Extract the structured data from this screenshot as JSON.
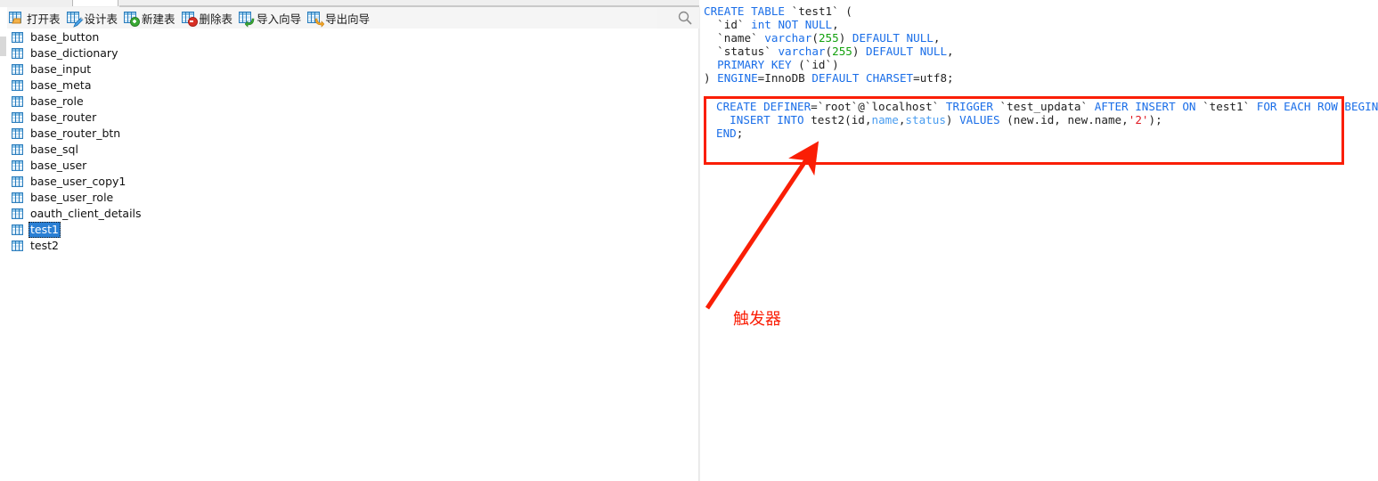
{
  "app": {
    "title": "Navicat - Table List and Trigger SQL"
  },
  "toolbar": {
    "buttons": [
      {
        "label": "打开表",
        "icon": "table-open-icon"
      },
      {
        "label": "设计表",
        "icon": "table-design-icon"
      },
      {
        "label": "新建表",
        "icon": "table-new-icon"
      },
      {
        "label": "删除表",
        "icon": "table-delete-icon"
      },
      {
        "label": "导入向导",
        "icon": "import-wizard-icon"
      },
      {
        "label": "导出向导",
        "icon": "export-wizard-icon"
      }
    ],
    "search_icon": "search-icon"
  },
  "table_list": {
    "items": [
      {
        "name": "base_button",
        "selected": false
      },
      {
        "name": "base_dictionary",
        "selected": false
      },
      {
        "name": "base_input",
        "selected": false
      },
      {
        "name": "base_meta",
        "selected": false
      },
      {
        "name": "base_role",
        "selected": false
      },
      {
        "name": "base_router",
        "selected": false
      },
      {
        "name": "base_router_btn",
        "selected": false
      },
      {
        "name": "base_sql",
        "selected": false
      },
      {
        "name": "base_user",
        "selected": false
      },
      {
        "name": "base_user_copy1",
        "selected": false
      },
      {
        "name": "base_user_role",
        "selected": false
      },
      {
        "name": "oauth_client_details",
        "selected": false
      },
      {
        "name": "test1",
        "selected": true
      },
      {
        "name": "test2",
        "selected": false
      }
    ]
  },
  "sql": {
    "create_table": {
      "line1": "CREATE TABLE `test1` (",
      "line2": "  `id` int NOT NULL,",
      "line3": "  `name` varchar(255) DEFAULT NULL,",
      "line4": "  `status` varchar(255) DEFAULT NULL,",
      "line5": "  PRIMARY KEY (`id`)",
      "line6": ") ENGINE=InnoDB DEFAULT CHARSET=utf8;"
    },
    "trigger": {
      "line1": "CREATE DEFINER=`root`@`localhost` TRIGGER `test_updata` AFTER INSERT ON `test1` FOR EACH ROW BEGIN",
      "line2": "  INSERT INTO test2(id,name,status) VALUES (new.id, new.name,'2');",
      "line3": "END;"
    }
  },
  "annotation": {
    "label": "触发器",
    "color": "#fa1e05",
    "box_color": "#fa1e05"
  },
  "colors": {
    "keyword": "#1a6ee8",
    "number": "#13a10e",
    "string": "#e01b24",
    "column": "#4a9df0",
    "selection": "#2a7fd4",
    "toolbar_bg": "#f4f4f4",
    "icon_blue": "#2b7dbd",
    "badge_green": "#3aaa35",
    "badge_red": "#d93025"
  }
}
